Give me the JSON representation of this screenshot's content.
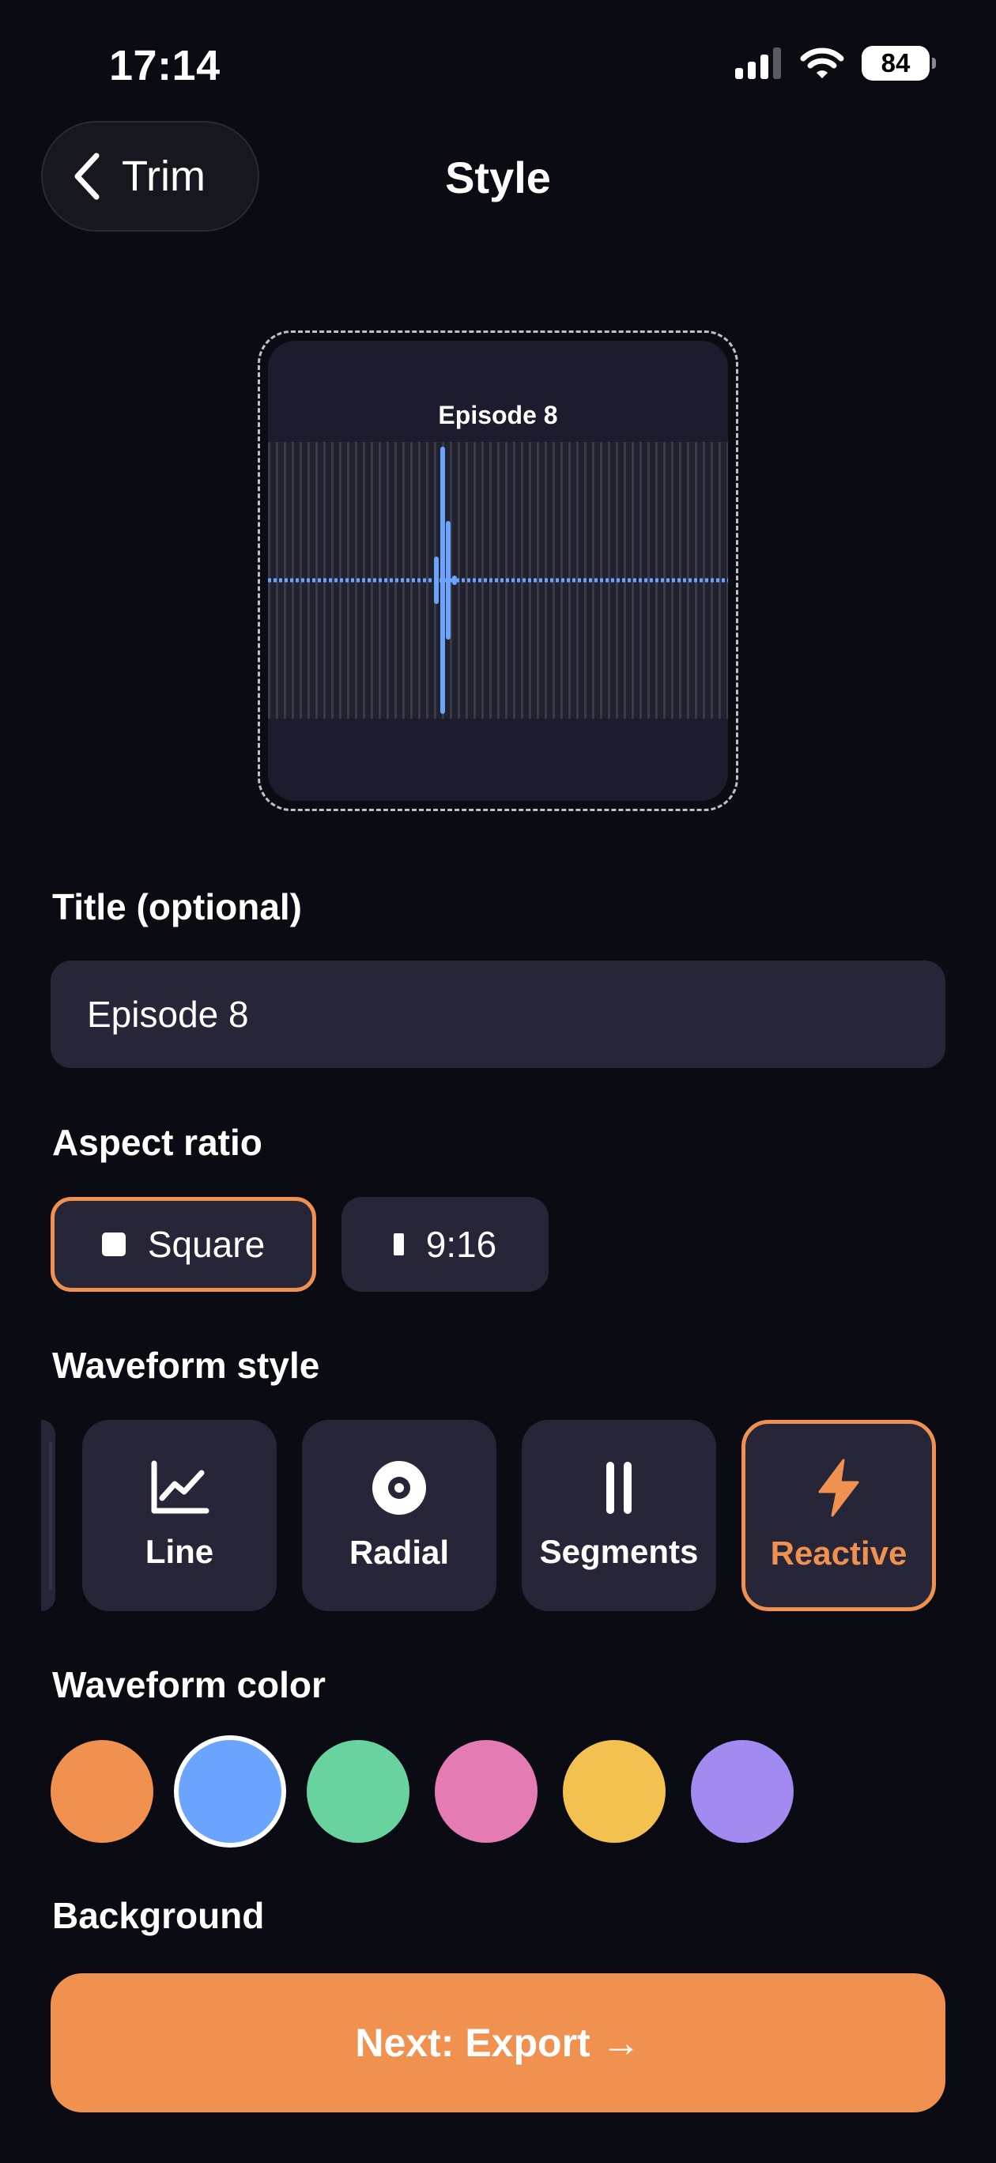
{
  "status_bar": {
    "time": "17:14",
    "battery": "84",
    "icons": [
      "signal-icon",
      "wifi-icon",
      "battery-icon"
    ]
  },
  "nav": {
    "back_label": "Trim",
    "title": "Style"
  },
  "preview": {
    "title": "Episode 8",
    "waveform_color": "#6aa4ff"
  },
  "title_field": {
    "label": "Title (optional)",
    "value": "Episode 8"
  },
  "aspect_ratio": {
    "label": "Aspect ratio",
    "options": [
      {
        "label": "Square",
        "icon": "square-icon",
        "selected": true
      },
      {
        "label": "9:16",
        "icon": "portrait-icon",
        "selected": false
      }
    ]
  },
  "waveform_style": {
    "label": "Waveform style",
    "options": [
      {
        "label": "Line",
        "icon": "line-chart-icon",
        "selected": false
      },
      {
        "label": "Radial",
        "icon": "radial-icon",
        "selected": false
      },
      {
        "label": "Segments",
        "icon": "segments-icon",
        "selected": false
      },
      {
        "label": "Reactive",
        "icon": "bolt-icon",
        "selected": true
      }
    ]
  },
  "waveform_color": {
    "label": "Waveform color",
    "colors": [
      "#f0914f",
      "#6aa4ff",
      "#68d39e",
      "#e47bb2",
      "#f2c14f",
      "#a18af0"
    ],
    "selected_index": 1
  },
  "background": {
    "label": "Background"
  },
  "footer": {
    "next_label": "Next: Export →"
  },
  "accent_color": "#f0914f"
}
